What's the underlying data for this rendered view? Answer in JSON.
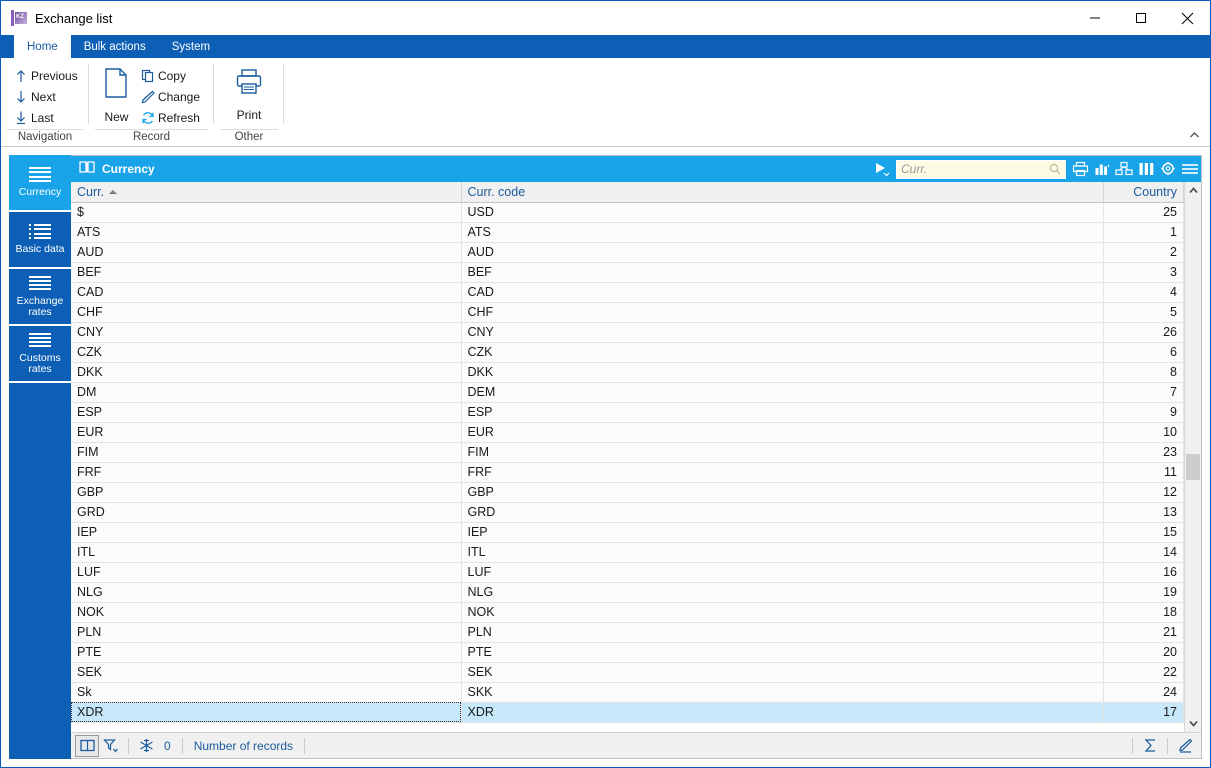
{
  "window": {
    "title": "Exchange list",
    "icon": "app-icon",
    "controls": {
      "minimize": "minimize-icon",
      "maximize": "maximize-icon",
      "close": "close-icon"
    }
  },
  "ribbon": {
    "tabs": [
      {
        "label": "Home",
        "active": true
      },
      {
        "label": "Bulk actions",
        "active": false
      },
      {
        "label": "System",
        "active": false
      }
    ],
    "groups": [
      {
        "label": "Navigation",
        "items": [
          {
            "label": "Previous",
            "icon": "arrow-up-icon"
          },
          {
            "label": "Next",
            "icon": "arrow-down-icon"
          },
          {
            "label": "Last",
            "icon": "arrow-down-to-line-icon"
          }
        ]
      },
      {
        "label": "Record",
        "big": {
          "label": "New",
          "icon": "new-document-icon"
        },
        "items": [
          {
            "label": "Copy",
            "icon": "copy-icon"
          },
          {
            "label": "Change",
            "icon": "pencil-icon"
          },
          {
            "label": "Refresh",
            "icon": "refresh-icon"
          }
        ]
      },
      {
        "label": "Other",
        "big": {
          "label": "Print",
          "icon": "printer-icon"
        },
        "items": []
      }
    ],
    "collapse_icon": "chevron-up-icon"
  },
  "sidebar": {
    "items": [
      {
        "label": "Currency",
        "icon": "list-lines-icon",
        "active": true
      },
      {
        "label": "Basic data",
        "icon": "list-bullets-icon",
        "active": false
      },
      {
        "label": "Exchange rates",
        "label_line1": "Exchange",
        "label_line2": "rates",
        "icon": "list-lines-icon",
        "active": false
      },
      {
        "label": "Customs rates",
        "label_line1": "Customs",
        "label_line2": "rates",
        "icon": "list-lines-icon",
        "active": false
      }
    ]
  },
  "panel": {
    "title": "Currency",
    "title_icon": "book-icon",
    "play_icon": "play-dropdown-icon",
    "search": {
      "value": "",
      "placeholder": "Curr.",
      "icon": "search-icon"
    },
    "tools": [
      {
        "name": "print-icon"
      },
      {
        "name": "chart-icon"
      },
      {
        "name": "pivot-icon"
      },
      {
        "name": "columns-icon"
      },
      {
        "name": "settings-gear-icon"
      },
      {
        "name": "menu-hamburger-icon"
      }
    ]
  },
  "table": {
    "columns": [
      {
        "label": "Curr.",
        "sort": "asc",
        "align": "left"
      },
      {
        "label": "Curr. code",
        "sort": "",
        "align": "left"
      },
      {
        "label": "Country",
        "sort": "",
        "align": "right"
      }
    ],
    "rows": [
      {
        "curr": "$",
        "code": "USD",
        "country": "25",
        "selected": false
      },
      {
        "curr": "ATS",
        "code": "ATS",
        "country": "1",
        "selected": false
      },
      {
        "curr": "AUD",
        "code": "AUD",
        "country": "2",
        "selected": false
      },
      {
        "curr": "BEF",
        "code": "BEF",
        "country": "3",
        "selected": false
      },
      {
        "curr": "CAD",
        "code": "CAD",
        "country": "4",
        "selected": false
      },
      {
        "curr": "CHF",
        "code": "CHF",
        "country": "5",
        "selected": false
      },
      {
        "curr": "CNY",
        "code": "CNY",
        "country": "26",
        "selected": false
      },
      {
        "curr": "CZK",
        "code": "CZK",
        "country": "6",
        "selected": false
      },
      {
        "curr": "DKK",
        "code": "DKK",
        "country": "8",
        "selected": false
      },
      {
        "curr": "DM",
        "code": "DEM",
        "country": "7",
        "selected": false
      },
      {
        "curr": "ESP",
        "code": "ESP",
        "country": "9",
        "selected": false
      },
      {
        "curr": "EUR",
        "code": "EUR",
        "country": "10",
        "selected": false
      },
      {
        "curr": "FIM",
        "code": "FIM",
        "country": "23",
        "selected": false
      },
      {
        "curr": "FRF",
        "code": "FRF",
        "country": "11",
        "selected": false
      },
      {
        "curr": "GBP",
        "code": "GBP",
        "country": "12",
        "selected": false
      },
      {
        "curr": "GRD",
        "code": "GRD",
        "country": "13",
        "selected": false
      },
      {
        "curr": "IEP",
        "code": "IEP",
        "country": "15",
        "selected": false
      },
      {
        "curr": "ITL",
        "code": "ITL",
        "country": "14",
        "selected": false
      },
      {
        "curr": "LUF",
        "code": "LUF",
        "country": "16",
        "selected": false
      },
      {
        "curr": "NLG",
        "code": "NLG",
        "country": "19",
        "selected": false
      },
      {
        "curr": "NOK",
        "code": "NOK",
        "country": "18",
        "selected": false
      },
      {
        "curr": "PLN",
        "code": "PLN",
        "country": "21",
        "selected": false
      },
      {
        "curr": "PTE",
        "code": "PTE",
        "country": "20",
        "selected": false
      },
      {
        "curr": "SEK",
        "code": "SEK",
        "country": "22",
        "selected": false
      },
      {
        "curr": "Sk",
        "code": "SKK",
        "country": "24",
        "selected": false
      },
      {
        "curr": "XDR",
        "code": "XDR",
        "country": "17",
        "selected": true
      }
    ]
  },
  "statusbar": {
    "book_icon": "book-icon",
    "filter_icon": "filter-dropdown-icon",
    "snowflake_icon": "snowflake-icon",
    "count": "0",
    "records_label": "Number of records",
    "sum_icon": "sigma-icon",
    "edit_icon": "pencil-icon"
  },
  "colors": {
    "ribbon_blue": "#0d5fb5",
    "panel_blue": "#19a3e8",
    "selection": "#c6e8fa",
    "search_bg": "#fdfbe4",
    "header_text": "#1b5b9e"
  }
}
